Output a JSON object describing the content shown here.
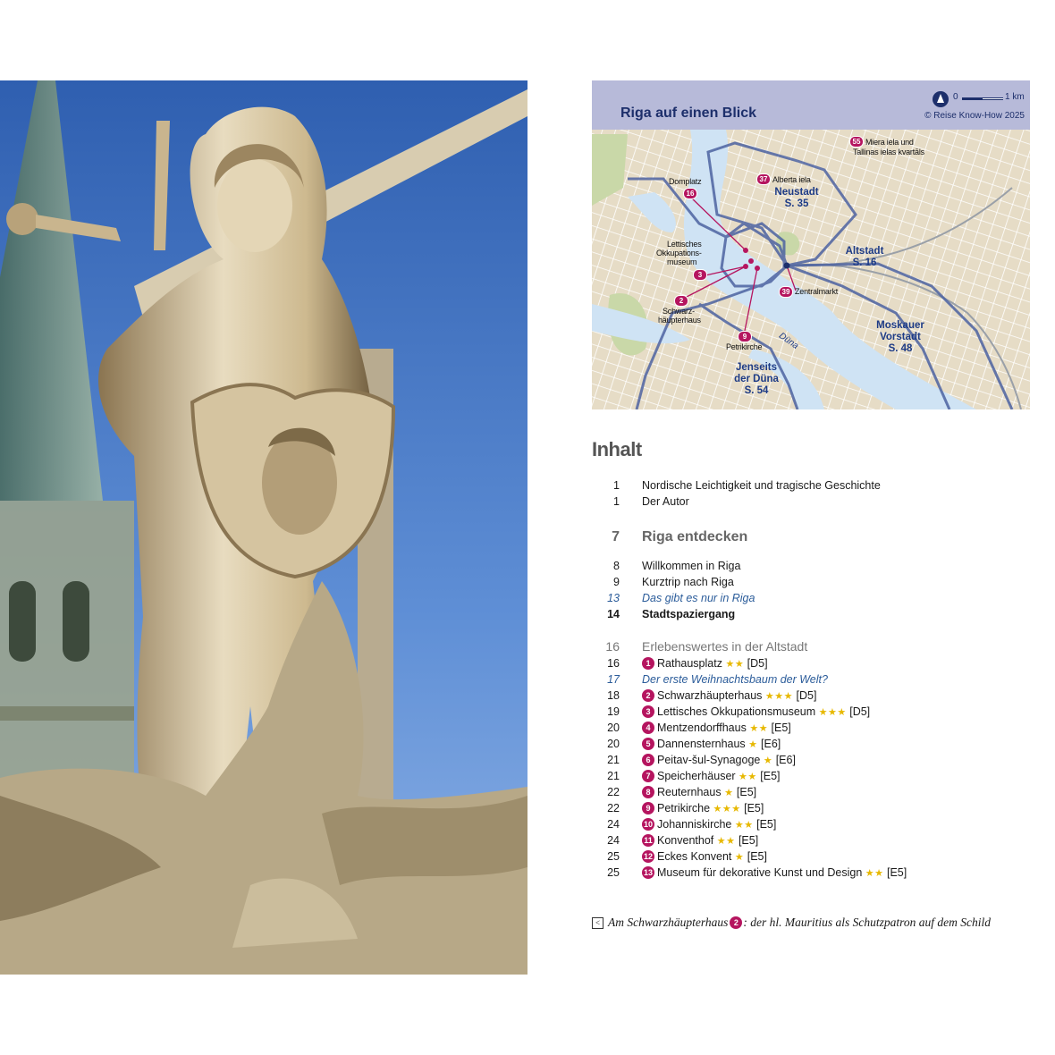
{
  "map": {
    "title": "Riga auf einen Blick",
    "scale_start": "0",
    "scale_end": "1 km",
    "copyright": "© Reise Know-How 2025",
    "labels": {
      "miera": "Miera iela und",
      "miera2": "Tallinas ielas kvartāls",
      "alberta": "Alberta iela",
      "domplatz": "Domplatz",
      "lettisches1": "Lettisches",
      "lettisches2": "Okkupations-",
      "lettisches3": "museum",
      "schwarz1": "Schwarz-",
      "schwarz2": "häupterhaus",
      "petrikirche": "Petrikirche",
      "zentralmarkt": "Zentralmarkt",
      "duna": "Düna"
    },
    "pins": {
      "p55": "55",
      "p37": "37",
      "p16": "16",
      "p3": "3",
      "p2": "2",
      "p9": "9",
      "p39": "39"
    },
    "districts": {
      "neustadt": "Neustadt",
      "neustadt_page": "S. 35",
      "altstadt": "Altstadt",
      "altstadt_page": "S. 16",
      "moskauer1": "Moskauer",
      "moskauer2": "Vorstadt",
      "moskauer_page": "S. 48",
      "jenseits1": "Jenseits",
      "jenseits2": "der Düna",
      "jenseits_page": "S. 54"
    }
  },
  "toc": {
    "heading": "Inhalt",
    "rows": [
      {
        "page": "1",
        "text": "Nordische Leichtigkeit und tragische Geschichte"
      },
      {
        "page": "1",
        "text": "Der Autor"
      },
      {
        "page": "7",
        "text": "Riga entdecken"
      },
      {
        "page": "8",
        "text": "Willkommen in Riga"
      },
      {
        "page": "9",
        "text": "Kurztrip nach Riga"
      },
      {
        "page": "13",
        "text": "Das gibt es nur in Riga"
      },
      {
        "page": "14",
        "text": "Stadtspaziergang"
      },
      {
        "page": "16",
        "text": "Erlebenswertes in der Altstadt"
      },
      {
        "page": "16",
        "poi": "1",
        "text": "Rathausplatz",
        "stars": "★★",
        "grid": "[D5]"
      },
      {
        "page": "17",
        "text": "Der erste Weihnachtsbaum der Welt?"
      },
      {
        "page": "18",
        "poi": "2",
        "text": "Schwarzhäupterhaus",
        "stars": "★★★",
        "grid": "[D5]"
      },
      {
        "page": "19",
        "poi": "3",
        "text": "Lettisches Okkupationsmuseum",
        "stars": "★★★",
        "grid": "[D5]"
      },
      {
        "page": "20",
        "poi": "4",
        "text": "Mentzendorffhaus",
        "stars": "★★",
        "grid": "[E5]"
      },
      {
        "page": "20",
        "poi": "5",
        "text": "Dannensternhaus",
        "stars": "★",
        "grid": "[E6]"
      },
      {
        "page": "21",
        "poi": "6",
        "text": "Peitav-šul-Synagoge",
        "stars": "★",
        "grid": "[E6]"
      },
      {
        "page": "21",
        "poi": "7",
        "text": "Speicherhäuser",
        "stars": "★★",
        "grid": "[E5]"
      },
      {
        "page": "22",
        "poi": "8",
        "text": "Reuternhaus",
        "stars": "★",
        "grid": "[E5]"
      },
      {
        "page": "22",
        "poi": "9",
        "text": "Petrikirche",
        "stars": "★★★",
        "grid": "[E5]"
      },
      {
        "page": "24",
        "poi": "10",
        "text": "Johanniskirche",
        "stars": "★★",
        "grid": "[E5]"
      },
      {
        "page": "24",
        "poi": "11",
        "text": "Konventhof",
        "stars": "★★",
        "grid": "[E5]"
      },
      {
        "page": "25",
        "poi": "12",
        "text": "Eckes Konvent",
        "stars": "★",
        "grid": "[E5]"
      },
      {
        "page": "25",
        "poi": "13",
        "text": "Museum für dekorative Kunst und Design",
        "stars": "★★",
        "grid": "[E5]"
      }
    ]
  },
  "caption": {
    "arrow": "<",
    "before": "Am Schwarzhäupterhaus",
    "poi": "2",
    "after": ": der hl. Mauritius als Schutzpatron auf dem Schild"
  }
}
